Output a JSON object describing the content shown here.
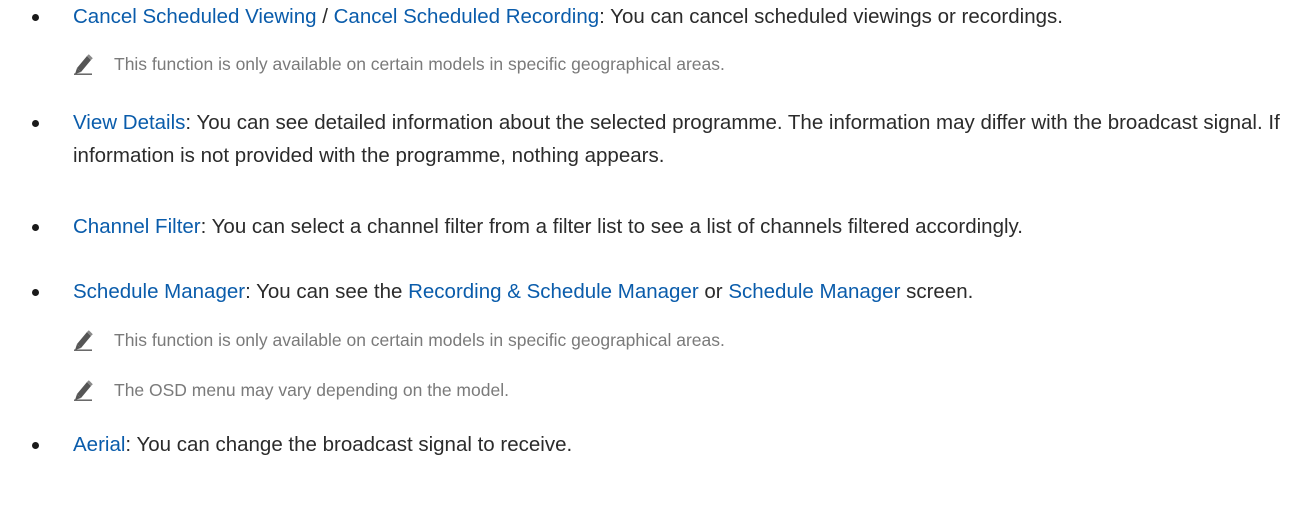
{
  "items": [
    {
      "parts": [
        {
          "text": "Cancel Scheduled Viewing",
          "term": true
        },
        {
          "text": " / ",
          "term": false
        },
        {
          "text": "Cancel Scheduled Recording",
          "term": true
        },
        {
          "text": ": You can cancel scheduled viewings or recordings.",
          "term": false
        }
      ]
    },
    {
      "parts": [
        {
          "text": "View Details",
          "term": true
        },
        {
          "text": ": You can see detailed information about the selected programme. The information may differ with the broadcast signal. If information is not provided with the programme, nothing appears.",
          "term": false
        }
      ]
    },
    {
      "parts": [
        {
          "text": "Channel Filter",
          "term": true
        },
        {
          "text": ": You can select a channel filter from a filter list to see a list of channels filtered accordingly.",
          "term": false
        }
      ]
    },
    {
      "parts": [
        {
          "text": "Schedule Manager",
          "term": true
        },
        {
          "text": ": You can see the ",
          "term": false
        },
        {
          "text": "Recording & Schedule Manager",
          "term": true
        },
        {
          "text": " or ",
          "term": false
        },
        {
          "text": "Schedule Manager",
          "term": true
        },
        {
          "text": " screen.",
          "term": false
        }
      ]
    },
    {
      "parts": [
        {
          "text": "Aerial",
          "term": true
        },
        {
          "text": ": You can change the broadcast signal to receive.",
          "term": false
        }
      ]
    }
  ],
  "notes": [
    {
      "icon": "pencil-icon",
      "text": "This function is only available on certain models in specific geographical areas."
    },
    {
      "icon": "pencil-icon",
      "text": "This function is only available on certain models in specific geographical areas."
    },
    {
      "icon": "pencil-icon",
      "text": "The OSD menu may vary depending on the model."
    }
  ],
  "colors": {
    "term": "#0a5cab",
    "body_text": "#2b2b2b",
    "note_text": "#7a7a7a"
  }
}
